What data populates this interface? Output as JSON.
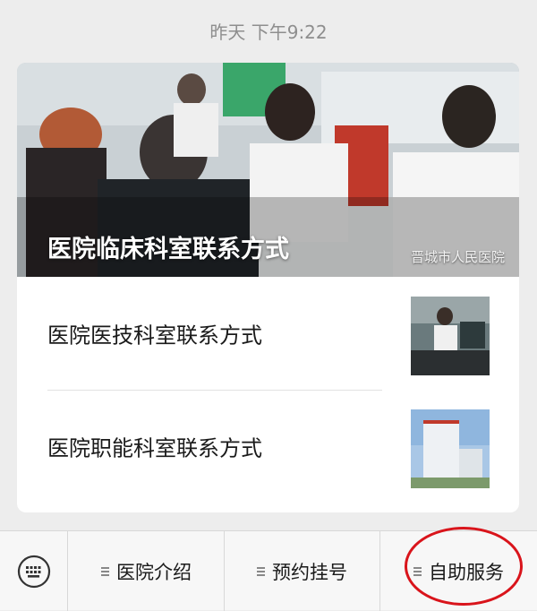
{
  "timestamp": "昨天 下午9:22",
  "message": {
    "hero": {
      "title": "医院临床科室联系方式",
      "watermark": "晋城市人民医院"
    },
    "articles": [
      {
        "title": "医院医技科室联系方式"
      },
      {
        "title": "医院职能科室联系方式"
      }
    ]
  },
  "menu": {
    "keyboard_icon": "keyboard-icon",
    "items": [
      {
        "label": "医院介绍"
      },
      {
        "label": "预约挂号"
      },
      {
        "label": "自助服务"
      }
    ]
  },
  "colors": {
    "background": "#ededed",
    "card": "#ffffff",
    "annotation": "#d9141b"
  }
}
